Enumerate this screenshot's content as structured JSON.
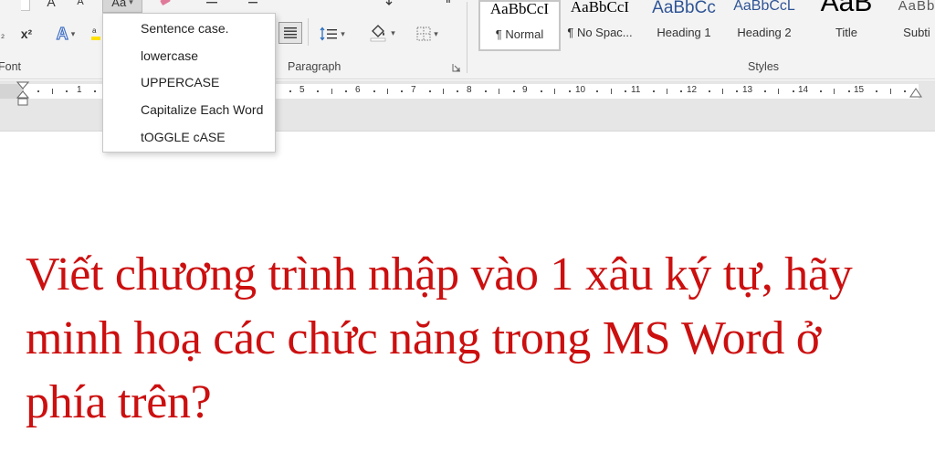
{
  "ribbon": {
    "groups": {
      "font": "Font",
      "paragraph": "Paragraph",
      "styles": "Styles"
    },
    "font_glyphs": {
      "superscript": "x²",
      "subscript": "₂",
      "grow": "A",
      "shrink": "A",
      "text_effects": "A",
      "change_case": "Aa"
    }
  },
  "styles": [
    {
      "sample": "AaBbCcI",
      "name": "¶ Normal"
    },
    {
      "sample": "AaBbCcI",
      "name": "¶ No Spac..."
    },
    {
      "sample": "AaBbCc",
      "name": "Heading 1"
    },
    {
      "sample": "AaBbCcL",
      "name": "Heading 2"
    },
    {
      "sample": "AaB",
      "name": "Title"
    },
    {
      "sample": "AaBb",
      "name": "Subti"
    }
  ],
  "colors": {
    "heading_blue": "#2f5496",
    "body_red": "#cc0f0f",
    "text_effects_blue": "#4472c4"
  },
  "change_case_menu": {
    "items": [
      {
        "label": "Sentence case."
      },
      {
        "label": "lowercase"
      },
      {
        "label": "UPPERCASE"
      },
      {
        "label": "Capitalize Each Word"
      },
      {
        "label": "tOGGLE cASE"
      }
    ]
  },
  "ruler": {
    "numbers": [
      "1",
      "5",
      "6",
      "7",
      "8",
      "9",
      "10",
      "11",
      "12",
      "13",
      "14",
      "15"
    ]
  },
  "document": {
    "lines": [
      "Viết chương trình nhập vào 1 xâu ký tự, hãy",
      "minh hoạ các chức năng trong MS Word ở",
      "phía trên?"
    ]
  }
}
